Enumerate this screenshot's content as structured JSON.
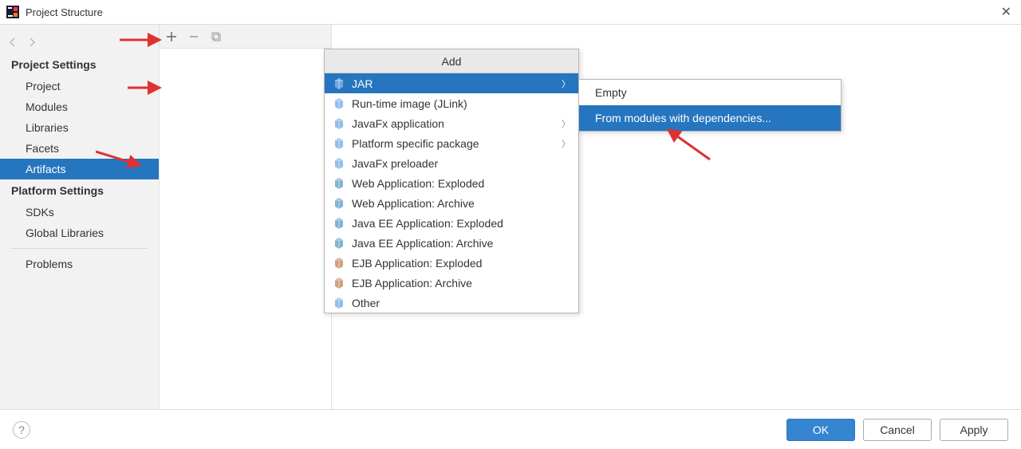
{
  "window": {
    "title": "Project Structure"
  },
  "sidebar": {
    "section_project": "Project Settings",
    "items_project": [
      "Project",
      "Modules",
      "Libraries",
      "Facets",
      "Artifacts"
    ],
    "section_platform": "Platform Settings",
    "items_platform": [
      "SDKs",
      "Global Libraries"
    ],
    "problems": "Problems",
    "selected": "Artifacts"
  },
  "menu": {
    "title": "Add",
    "items": [
      {
        "label": "JAR",
        "has_sub": true,
        "icon": "module"
      },
      {
        "label": "Run-time image (JLink)",
        "has_sub": false,
        "icon": "module"
      },
      {
        "label": "JavaFx application",
        "has_sub": true,
        "icon": "module"
      },
      {
        "label": "Platform specific package",
        "has_sub": true,
        "icon": "module"
      },
      {
        "label": "JavaFx preloader",
        "has_sub": false,
        "icon": "module"
      },
      {
        "label": "Web Application: Exploded",
        "has_sub": false,
        "icon": "web"
      },
      {
        "label": "Web Application: Archive",
        "has_sub": false,
        "icon": "web"
      },
      {
        "label": "Java EE Application: Exploded",
        "has_sub": false,
        "icon": "jee"
      },
      {
        "label": "Java EE Application: Archive",
        "has_sub": false,
        "icon": "jee"
      },
      {
        "label": "EJB Application: Exploded",
        "has_sub": false,
        "icon": "ejb"
      },
      {
        "label": "EJB Application: Archive",
        "has_sub": false,
        "icon": "ejb"
      },
      {
        "label": "Other",
        "has_sub": false,
        "icon": "module"
      }
    ],
    "selected_index": 0
  },
  "submenu": {
    "items": [
      "Empty",
      "From modules with dependencies..."
    ],
    "selected_index": 1
  },
  "footer": {
    "ok": "OK",
    "cancel": "Cancel",
    "apply": "Apply"
  }
}
